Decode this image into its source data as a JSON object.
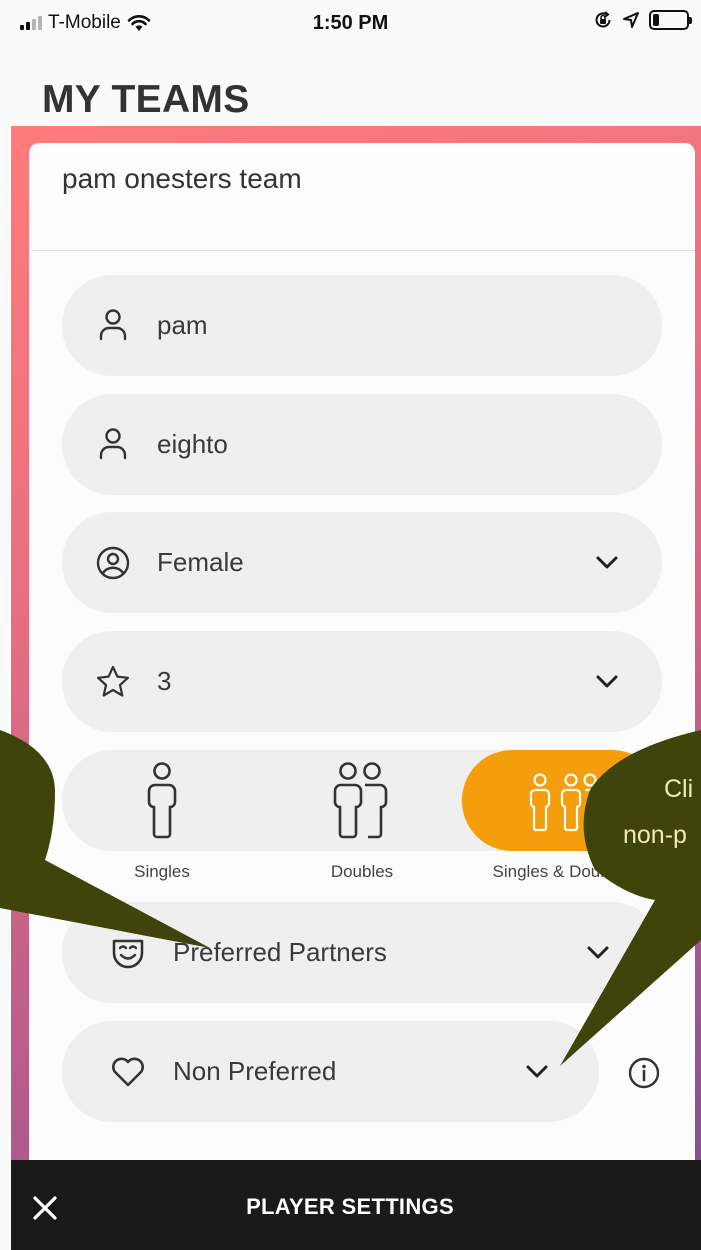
{
  "status": {
    "carrier": "T-Mobile",
    "time": "1:50 PM",
    "battery_level": 0.2
  },
  "page_title": "MY TEAMS",
  "team": {
    "name": "pam onesters team"
  },
  "fields": {
    "first_name": {
      "value": "pam",
      "icon": "person-icon"
    },
    "last_name": {
      "value": "eighto",
      "icon": "person-icon"
    },
    "gender": {
      "value": "Female",
      "icon": "gender-icon"
    },
    "rating": {
      "value": "3",
      "icon": "star-icon"
    },
    "preferred_partners": {
      "label": "Preferred Partners",
      "icon": "face-mask-icon"
    },
    "non_preferred": {
      "label": "Non Preferred",
      "icon": "heart-icon"
    }
  },
  "play_modes": {
    "selected": "Singles & Doubles",
    "items": [
      {
        "label": "Singles",
        "icon": "single-player-icon"
      },
      {
        "label": "Doubles",
        "icon": "two-players-icon"
      },
      {
        "label": "Singles & Doubles",
        "icon": "singles-doubles-icon"
      }
    ]
  },
  "tooltip": {
    "line1": "Cli",
    "line2": "non-p"
  },
  "bottom_bar": {
    "title": "PLAYER SETTINGS"
  },
  "colors": {
    "accent": "#f59e0b",
    "gradient_start": "#ff7b7b",
    "gradient_end": "#7a4b99",
    "bubble": "#3f440b",
    "field_bg": "#efefef",
    "bottom_bar": "#1a1a1a"
  }
}
